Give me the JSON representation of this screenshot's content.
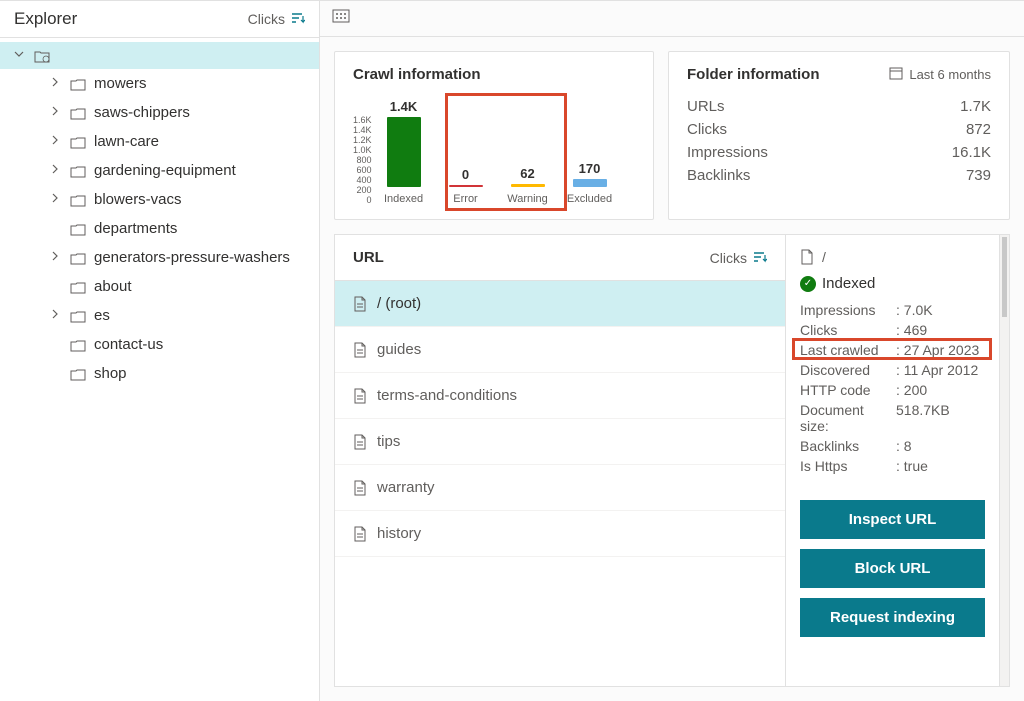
{
  "sidebar": {
    "title": "Explorer",
    "sort_label": "Clicks",
    "items": [
      {
        "label": "mowers",
        "expandable": true
      },
      {
        "label": "saws-chippers",
        "expandable": true
      },
      {
        "label": "lawn-care",
        "expandable": true
      },
      {
        "label": "gardening-equipment",
        "expandable": true
      },
      {
        "label": "blowers-vacs",
        "expandable": true
      },
      {
        "label": "departments",
        "expandable": false
      },
      {
        "label": "generators-pressure-washers",
        "expandable": true
      },
      {
        "label": "about",
        "expandable": false
      },
      {
        "label": "es",
        "expandable": true
      },
      {
        "label": "contact-us",
        "expandable": false
      },
      {
        "label": "shop",
        "expandable": false
      }
    ]
  },
  "crawl_card": {
    "title": "Crawl information"
  },
  "chart_data": {
    "type": "bar",
    "categories": [
      "Indexed",
      "Error",
      "Warning",
      "Excluded"
    ],
    "values": [
      1400,
      0,
      62,
      170
    ],
    "display_values": [
      "1.4K",
      "0",
      "62",
      "170"
    ],
    "colors": [
      "#107c10",
      "#d13438",
      "#ffb900",
      "#69afe5"
    ],
    "y_ticks": [
      "1.6K",
      "1.4K",
      "1.2K",
      "1.0K",
      "800",
      "600",
      "400",
      "200",
      "0"
    ],
    "ymax": 1600,
    "title": "Crawl information"
  },
  "folder_card": {
    "title": "Folder information",
    "timeframe": "Last 6 months",
    "stats": [
      {
        "label": "URLs",
        "value": "1.7K"
      },
      {
        "label": "Clicks",
        "value": "872"
      },
      {
        "label": "Impressions",
        "value": "16.1K"
      },
      {
        "label": "Backlinks",
        "value": "739"
      }
    ]
  },
  "url_panel": {
    "header": "URL",
    "sort_label": "Clicks",
    "items": [
      {
        "label": "/ (root)",
        "selected": true
      },
      {
        "label": "guides",
        "selected": false
      },
      {
        "label": "terms-and-conditions",
        "selected": false
      },
      {
        "label": "tips",
        "selected": false
      },
      {
        "label": "warranty",
        "selected": false
      },
      {
        "label": "history",
        "selected": false
      }
    ]
  },
  "detail": {
    "path": "/",
    "status": "Indexed",
    "rows": [
      {
        "key": "Impressions",
        "value": "7.0K"
      },
      {
        "key": "Clicks",
        "value": "469"
      },
      {
        "key": "Last crawled",
        "value": "27 Apr 2023",
        "highlighted": true
      },
      {
        "key": "Discovered",
        "value": "11 Apr 2012"
      },
      {
        "key": "HTTP code",
        "value": "200"
      },
      {
        "key": "Document size",
        "value": "518.7KB",
        "nosep": true
      },
      {
        "key": "Backlinks",
        "value": "8"
      },
      {
        "key": "Is Https",
        "value": "true"
      }
    ],
    "actions": [
      "Inspect URL",
      "Block URL",
      "Request indexing"
    ]
  }
}
